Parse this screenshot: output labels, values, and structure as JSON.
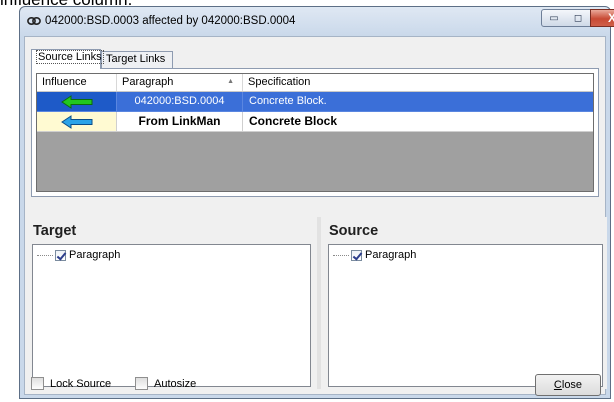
{
  "page": {
    "caption": "influence column."
  },
  "window": {
    "title": "042000:BSD.0003 affected by 042000:BSD.0004",
    "icon": "link-icon",
    "controls": {
      "minimize": "▭",
      "maximize": "◻",
      "close": "X"
    }
  },
  "tabs": [
    {
      "label": "Source Links",
      "active": true
    },
    {
      "label": "Target Links",
      "active": false
    }
  ],
  "grid": {
    "columns": [
      "Influence",
      "Paragraph",
      "Specification"
    ],
    "sort_indicator": "▲",
    "rows": [
      {
        "influence": "arrow-left-green-icon",
        "arrow_color": "#22c71e",
        "paragraph": "042000:BSD.0004",
        "specification": "Concrete Block.",
        "selected": true
      },
      {
        "influence": "arrow-left-blue-icon",
        "arrow_color": "#2ba3e8",
        "paragraph": "From LinkMan",
        "specification": "Concrete Block",
        "selected": false
      }
    ]
  },
  "target_pane": {
    "title": "Target",
    "tree": [
      {
        "label": "Paragraph",
        "checked": true
      }
    ]
  },
  "source_pane": {
    "title": "Source",
    "tree": [
      {
        "label": "Paragraph",
        "checked": true
      }
    ]
  },
  "footer": {
    "lock_source": {
      "label": "Lock Source",
      "checked": false
    },
    "autosize": {
      "label": "Autosize",
      "checked": false
    },
    "close_button": "Close"
  }
}
